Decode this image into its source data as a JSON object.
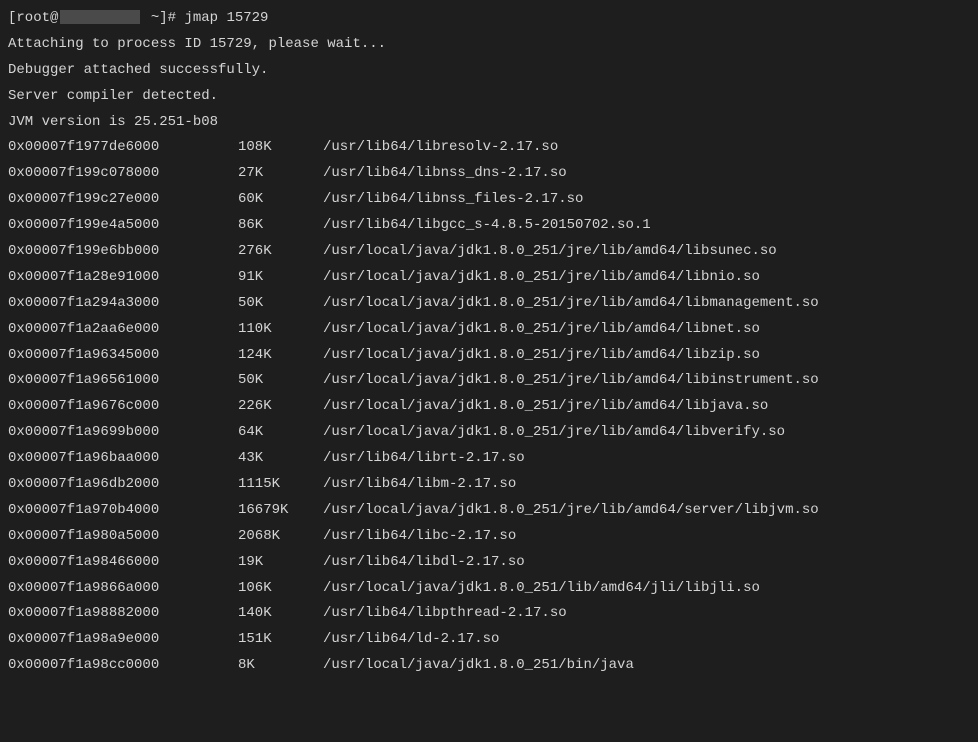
{
  "prompt": {
    "open_bracket": "[",
    "user": "root@",
    "tilde": " ~]# ",
    "command": "jmap 15729"
  },
  "messages": {
    "attaching": "Attaching to process ID 15729, please wait...",
    "debugger": "Debugger attached successfully.",
    "compiler": "Server compiler detected.",
    "jvm": "JVM version is 25.251-b08"
  },
  "rows": [
    {
      "addr": "0x00007f1977de6000",
      "size": "108K",
      "path": "/usr/lib64/libresolv-2.17.so"
    },
    {
      "addr": "0x00007f199c078000",
      "size": "27K",
      "path": "/usr/lib64/libnss_dns-2.17.so"
    },
    {
      "addr": "0x00007f199c27e000",
      "size": "60K",
      "path": "/usr/lib64/libnss_files-2.17.so"
    },
    {
      "addr": "0x00007f199e4a5000",
      "size": "86K",
      "path": "/usr/lib64/libgcc_s-4.8.5-20150702.so.1"
    },
    {
      "addr": "0x00007f199e6bb000",
      "size": "276K",
      "path": "/usr/local/java/jdk1.8.0_251/jre/lib/amd64/libsunec.so"
    },
    {
      "addr": "0x00007f1a28e91000",
      "size": "91K",
      "path": "/usr/local/java/jdk1.8.0_251/jre/lib/amd64/libnio.so"
    },
    {
      "addr": "0x00007f1a294a3000",
      "size": "50K",
      "path": "/usr/local/java/jdk1.8.0_251/jre/lib/amd64/libmanagement.so"
    },
    {
      "addr": "0x00007f1a2aa6e000",
      "size": "110K",
      "path": "/usr/local/java/jdk1.8.0_251/jre/lib/amd64/libnet.so"
    },
    {
      "addr": "0x00007f1a96345000",
      "size": "124K",
      "path": "/usr/local/java/jdk1.8.0_251/jre/lib/amd64/libzip.so"
    },
    {
      "addr": "0x00007f1a96561000",
      "size": "50K",
      "path": "/usr/local/java/jdk1.8.0_251/jre/lib/amd64/libinstrument.so"
    },
    {
      "addr": "0x00007f1a9676c000",
      "size": "226K",
      "path": "/usr/local/java/jdk1.8.0_251/jre/lib/amd64/libjava.so"
    },
    {
      "addr": "0x00007f1a9699b000",
      "size": "64K",
      "path": "/usr/local/java/jdk1.8.0_251/jre/lib/amd64/libverify.so"
    },
    {
      "addr": "0x00007f1a96baa000",
      "size": "43K",
      "path": "/usr/lib64/librt-2.17.so"
    },
    {
      "addr": "0x00007f1a96db2000",
      "size": "1115K",
      "path": "/usr/lib64/libm-2.17.so"
    },
    {
      "addr": "0x00007f1a970b4000",
      "size": "16679K",
      "path": "/usr/local/java/jdk1.8.0_251/jre/lib/amd64/server/libjvm.so"
    },
    {
      "addr": "0x00007f1a980a5000",
      "size": "2068K",
      "path": "/usr/lib64/libc-2.17.so"
    },
    {
      "addr": "0x00007f1a98466000",
      "size": "19K",
      "path": "/usr/lib64/libdl-2.17.so"
    },
    {
      "addr": "0x00007f1a9866a000",
      "size": "106K",
      "path": "/usr/local/java/jdk1.8.0_251/lib/amd64/jli/libjli.so"
    },
    {
      "addr": "0x00007f1a98882000",
      "size": "140K",
      "path": "/usr/lib64/libpthread-2.17.so"
    },
    {
      "addr": "0x00007f1a98a9e000",
      "size": "151K",
      "path": "/usr/lib64/ld-2.17.so"
    },
    {
      "addr": "0x00007f1a98cc0000",
      "size": "8K",
      "path": "/usr/local/java/jdk1.8.0_251/bin/java"
    }
  ]
}
